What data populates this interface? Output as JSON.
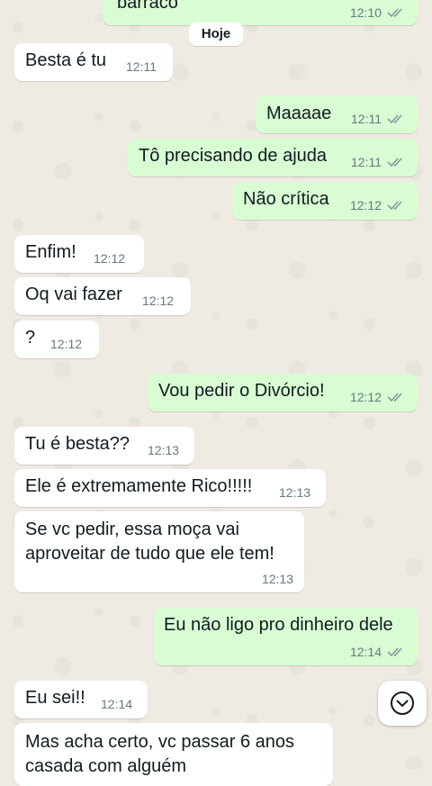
{
  "chat": {
    "day_divider": "Hoje",
    "messages": [
      {
        "text": "barraco",
        "time": "12:10"
      },
      {
        "text": "Besta é tu",
        "time": "12:11"
      },
      {
        "text": "Maaaae",
        "time": "12:11"
      },
      {
        "text": "Tô precisando de ajuda",
        "time": "12:11"
      },
      {
        "text": "Não crítica",
        "time": "12:12"
      },
      {
        "text": "Enfim!",
        "time": "12:12"
      },
      {
        "text": "Oq vai fazer",
        "time": "12:12"
      },
      {
        "text": "?",
        "time": "12:12"
      },
      {
        "text": "Vou pedir o Divórcio!",
        "time": "12:12"
      },
      {
        "text": "Tu é besta??",
        "time": "12:13"
      },
      {
        "text": "Ele é extremamente Rico!!!!!",
        "time": "12:13"
      },
      {
        "lines": [
          "Se vc pedir, essa moça vai",
          "aproveitar de tudo que ele tem!"
        ],
        "time": "12:13"
      },
      {
        "text": "Eu não ligo pro dinheiro dele",
        "time": "12:14"
      },
      {
        "text": "Eu sei!!",
        "time": "12:14"
      },
      {
        "lines": [
          "Mas acha certo, vc passar 6 anos",
          "casada com alguém"
        ]
      }
    ]
  },
  "colors": {
    "wallpaper": "#efeae2",
    "incoming_bubble": "#ffffff",
    "outgoing_bubble": "#d9fdd3",
    "read_ticks": "#8696a0"
  },
  "icons": {
    "read_receipt": "double-check-icon",
    "scroll_down": "chevron-down-icon"
  }
}
